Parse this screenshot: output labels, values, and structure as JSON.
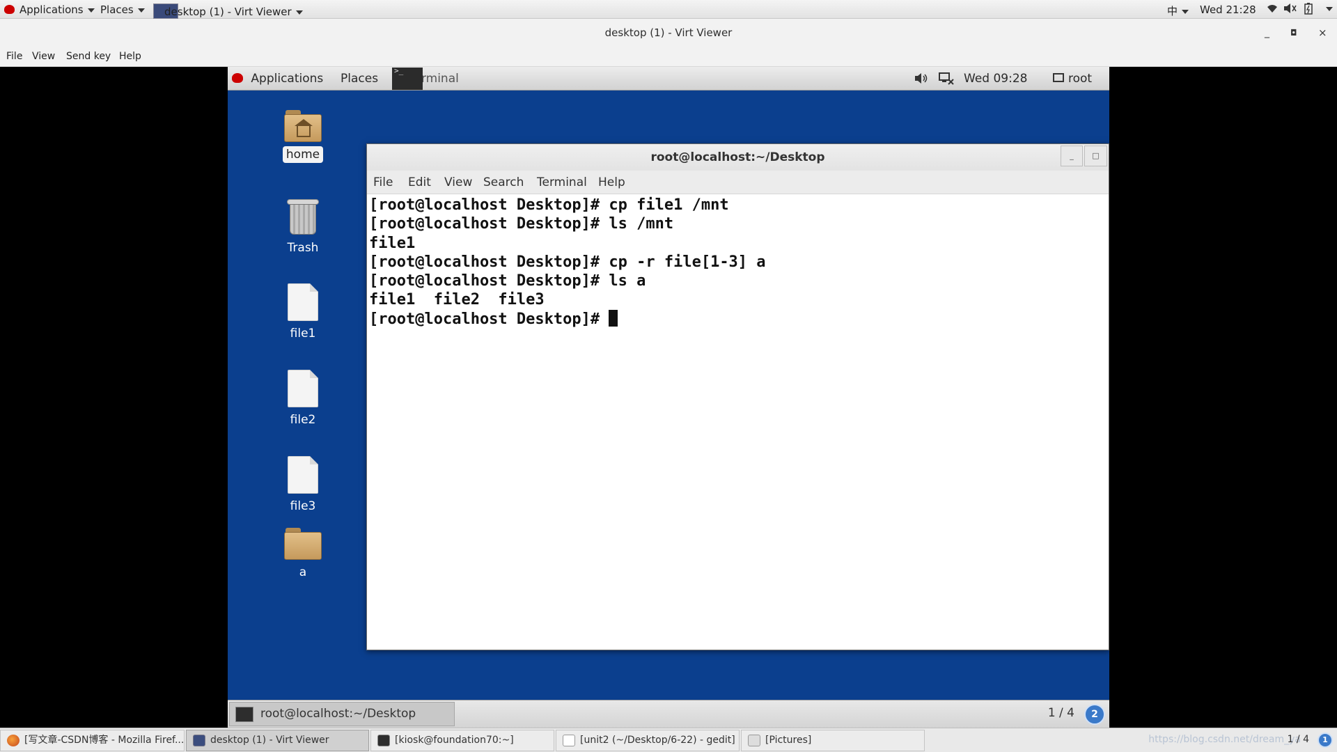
{
  "host_top": {
    "applications": "Applications",
    "places": "Places",
    "active_window": "desktop (1) - Virt Viewer",
    "input_method": "中",
    "clock": "Wed 21:28"
  },
  "virt_viewer": {
    "title": "desktop (1) - Virt Viewer",
    "menu": [
      "File",
      "View",
      "Send key",
      "Help"
    ]
  },
  "guest_top": {
    "applications": "Applications",
    "places": "Places",
    "terminal": "Terminal",
    "clock": "Wed 09:28",
    "user": "root"
  },
  "desktop_icons": [
    "home",
    "Trash",
    "file1",
    "file2",
    "file3",
    "a"
  ],
  "terminal": {
    "title": "root@localhost:~/Desktop",
    "menu": [
      "File",
      "Edit",
      "View",
      "Search",
      "Terminal",
      "Help"
    ],
    "lines": [
      "[root@localhost Desktop]# cp file1 /mnt",
      "[root@localhost Desktop]# ls /mnt",
      "file1",
      "[root@localhost Desktop]# cp -r file[1-3] a",
      "[root@localhost Desktop]# ls a",
      "file1  file2  file3",
      "[root@localhost Desktop]# "
    ]
  },
  "guest_bottom": {
    "task": "root@localhost:~/Desktop",
    "pager": "1 / 4",
    "workspace": "2"
  },
  "host_bottom": {
    "tasks": [
      "[写文章-CSDN博客 - Mozilla Firef...",
      "desktop (1) - Virt Viewer",
      "[kiosk@foundation70:~]",
      "[unit2 (~/Desktop/6-22) - gedit]",
      "[Pictures]"
    ],
    "watermark": "https://blog.csdn.net/dream_ya",
    "pager": "1 / 4",
    "workspace": "1"
  },
  "colors": {
    "guest_desktop": "#0b3f8e",
    "redhat": "#cc0000",
    "workspace_badge": "#3a79c9"
  }
}
